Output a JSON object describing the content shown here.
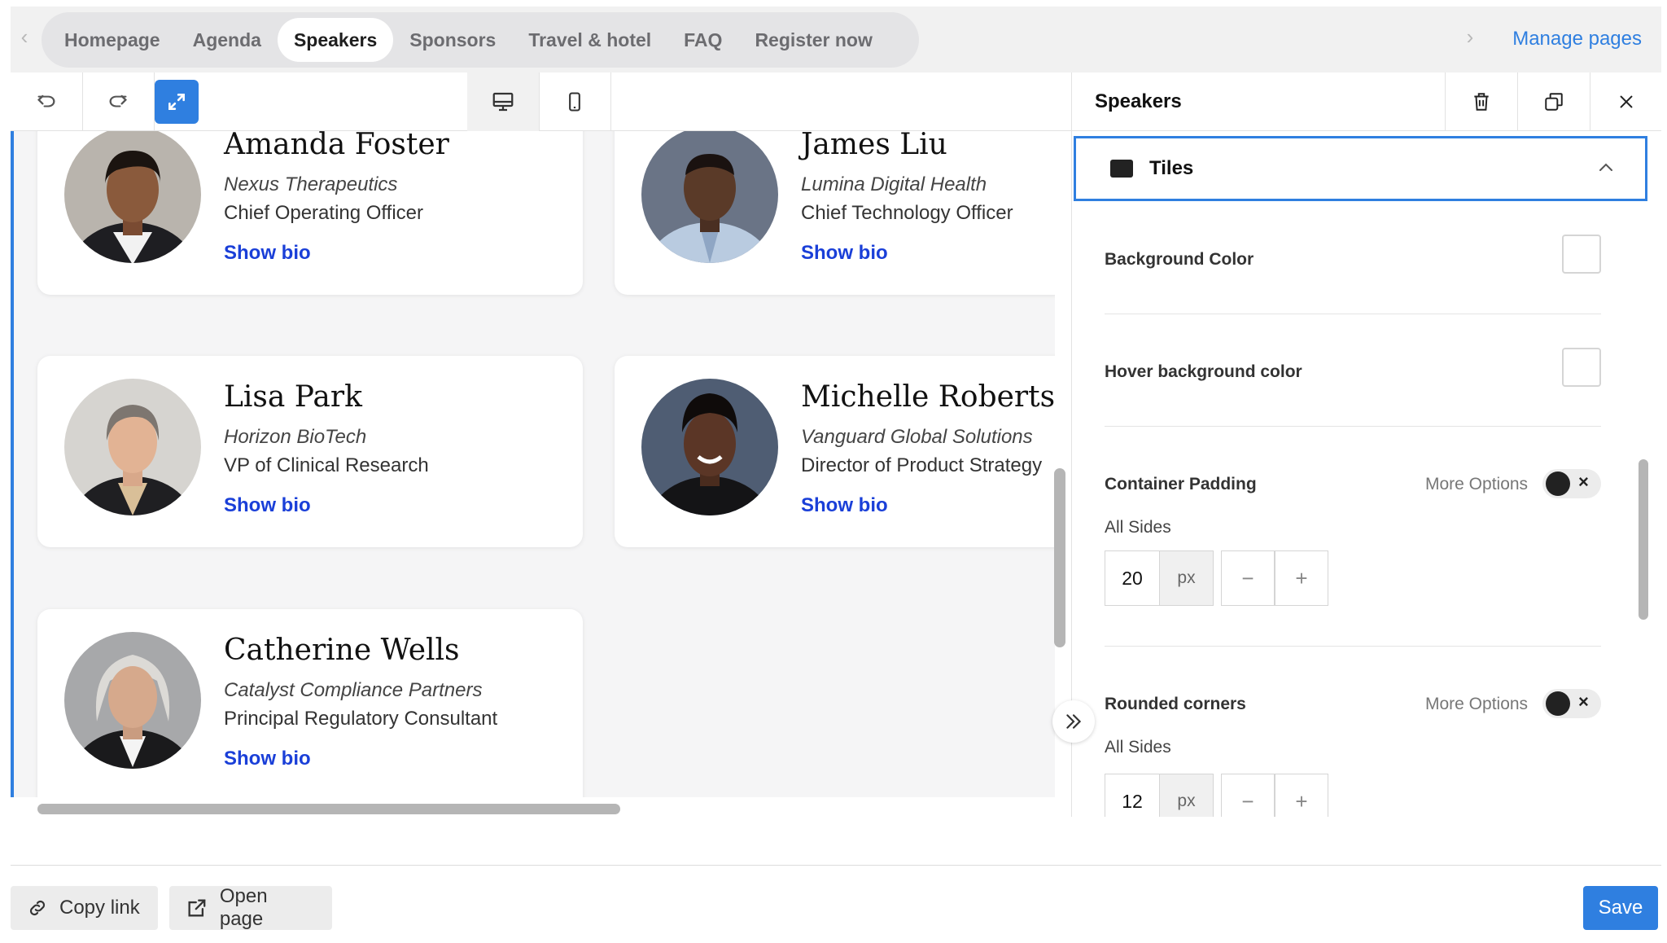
{
  "nav": {
    "tabs": [
      {
        "label": "Homepage"
      },
      {
        "label": "Agenda"
      },
      {
        "label": "Speakers"
      },
      {
        "label": "Sponsors"
      },
      {
        "label": "Travel & hotel"
      },
      {
        "label": "FAQ"
      },
      {
        "label": "Register now"
      }
    ],
    "active_tab": "Speakers",
    "manage_pages": "Manage pages"
  },
  "speakers": [
    {
      "name": "Amanda Foster",
      "company": "Nexus Therapeutics",
      "role": "Chief Operating Officer",
      "bio_link": "Show bio"
    },
    {
      "name": "James Liu",
      "company": "Lumina Digital Health",
      "role": "Chief Technology Officer",
      "bio_link": "Show bio"
    },
    {
      "name": "Lisa Park",
      "company": "Horizon BioTech",
      "role": "VP of Clinical Research",
      "bio_link": "Show bio"
    },
    {
      "name": "Michelle Roberts",
      "company": "Vanguard Global Solutions",
      "role": "Director of Product Strategy",
      "bio_link": "Show bio"
    },
    {
      "name": "Catherine Wells",
      "company": "Catalyst Compliance Partners",
      "role": "Principal Regulatory Consultant",
      "bio_link": "Show bio"
    }
  ],
  "panel": {
    "title": "Speakers",
    "section": "Tiles",
    "background_color_label": "Background Color",
    "hover_background_label": "Hover background color",
    "container_padding": {
      "label": "Container Padding",
      "more_options": "More Options",
      "sides_label": "All Sides",
      "value": "20",
      "unit": "px"
    },
    "rounded_corners": {
      "label": "Rounded corners",
      "more_options": "More Options",
      "sides_label": "All Sides",
      "value": "12",
      "unit": "px"
    },
    "stepper_minus": "−",
    "stepper_plus": "+"
  },
  "footer": {
    "copy_link": "Copy link",
    "open_page": "Open page",
    "save": "Save"
  },
  "colors": {
    "accent": "#2f7fe0",
    "bio_link": "#1a3fd8"
  }
}
